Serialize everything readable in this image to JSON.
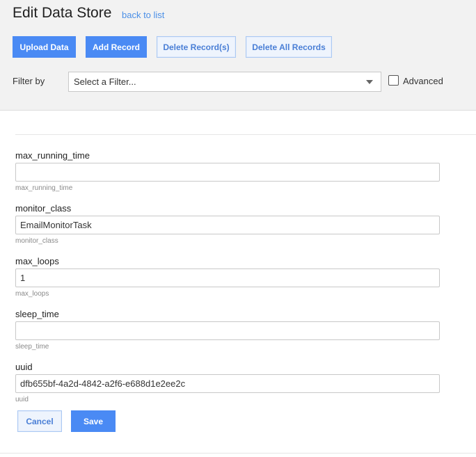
{
  "header": {
    "title": "Edit Data Store",
    "back_link": "back to list"
  },
  "toolbar": {
    "upload_label": "Upload Data",
    "add_label": "Add Record",
    "delete_label": "Delete Record(s)",
    "delete_all_label": "Delete All Records"
  },
  "filter": {
    "label": "Filter by",
    "placeholder": "Select a Filter...",
    "advanced_label": "Advanced",
    "advanced_checked": false
  },
  "fields": [
    {
      "label": "max_running_time",
      "value": "",
      "hint": "max_running_time"
    },
    {
      "label": "monitor_class",
      "value": "EmailMonitorTask",
      "hint": "monitor_class"
    },
    {
      "label": "max_loops",
      "value": "1",
      "hint": "max_loops"
    },
    {
      "label": "sleep_time",
      "value": "",
      "hint": "sleep_time"
    },
    {
      "label": "uuid",
      "value": "dfb655bf-4a2d-4842-a2f6-e688d1e2ee2c",
      "hint": "uuid"
    }
  ],
  "form_actions": {
    "cancel_label": "Cancel",
    "save_label": "Save"
  },
  "colors": {
    "accent": "#4a8af4",
    "link": "#4a8fe7",
    "header_bg": "#f2f2f2"
  }
}
